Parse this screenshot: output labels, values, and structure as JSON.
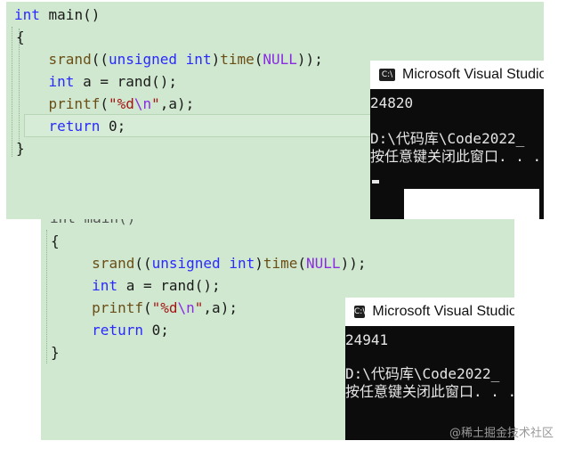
{
  "top": {
    "code": {
      "line1": {
        "kw": "int",
        "rest": " main()"
      },
      "line2": "{",
      "line3": {
        "fn": "srand",
        "p1": "((",
        "kw1": "unsigned",
        "sp": " ",
        "kw2": "int",
        "p2": ")",
        "fn2": "time",
        "p3": "(",
        "mac": "NULL",
        "p4": "));"
      },
      "line4": {
        "kw": "int",
        "rest": " a = rand();"
      },
      "line5": {
        "fn": "printf",
        "p1": "(",
        "s1": "\"%d",
        "esc": "\\n",
        "s2": "\"",
        "p2": ",a);"
      },
      "line6": {
        "kw": "return",
        "rest": " 0;"
      },
      "line7": "}"
    },
    "console": {
      "title": "Microsoft Visual Studio",
      "icon_text": "C:\\",
      "output": "24820",
      "path": "D:\\代码库\\Code2022_",
      "prompt": "按任意键关闭此窗口. . ."
    }
  },
  "bottom": {
    "code": {
      "line0": "int main()",
      "line1": "{",
      "line2": {
        "fn": "srand",
        "p1": "((",
        "kw1": "unsigned",
        "sp": " ",
        "kw2": "int",
        "p2": ")",
        "fn2": "time",
        "p3": "(",
        "mac": "NULL",
        "p4": "));"
      },
      "line3": {
        "kw": "int",
        "rest": " a = rand();"
      },
      "line4": {
        "fn": "printf",
        "p1": "(",
        "s1": "\"%d",
        "esc": "\\n",
        "s2": "\"",
        "p2": ",a);"
      },
      "line5": {
        "kw": "return",
        "rest": " 0;"
      },
      "line6": "}"
    },
    "console": {
      "title": "Microsoft Visual Studio",
      "icon_text": "C:\\",
      "output": "24941",
      "path": "D:\\代码库\\Code2022_",
      "prompt": "按任意键关闭此窗口. . ."
    }
  },
  "watermark": "@稀土掘金技术社区",
  "colors": {
    "editor_bg": "#cfe8cf",
    "keyword": "#2a2aff",
    "macro": "#8a2be2",
    "string": "#a31515",
    "console_bg": "#0c0c0c",
    "console_text": "#e6e6e6"
  }
}
